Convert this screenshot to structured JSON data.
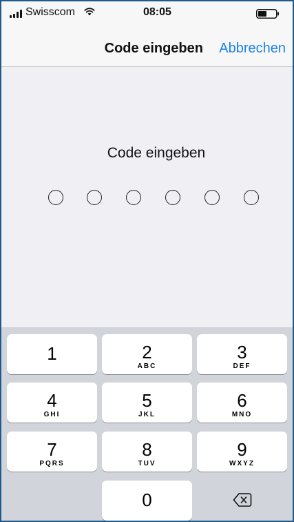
{
  "status_bar": {
    "carrier": "Swisscom",
    "time": "08:05"
  },
  "nav": {
    "title": "Code eingeben",
    "cancel": "Abbrechen"
  },
  "main": {
    "prompt": "Code eingeben",
    "code_length": 6,
    "entered_digits": 0
  },
  "keypad": {
    "keys": [
      {
        "digit": "1",
        "letters": ""
      },
      {
        "digit": "2",
        "letters": "ABC"
      },
      {
        "digit": "3",
        "letters": "DEF"
      },
      {
        "digit": "4",
        "letters": "GHI"
      },
      {
        "digit": "5",
        "letters": "JKL"
      },
      {
        "digit": "6",
        "letters": "MNO"
      },
      {
        "digit": "7",
        "letters": "PQRS"
      },
      {
        "digit": "8",
        "letters": "TUV"
      },
      {
        "digit": "9",
        "letters": "WXYZ"
      },
      {
        "digit": "0",
        "letters": ""
      }
    ],
    "backspace_icon": "backspace-icon"
  },
  "colors": {
    "accent": "#1a80f0",
    "background": "#efeff4",
    "keypad_background": "#d1d4da"
  }
}
